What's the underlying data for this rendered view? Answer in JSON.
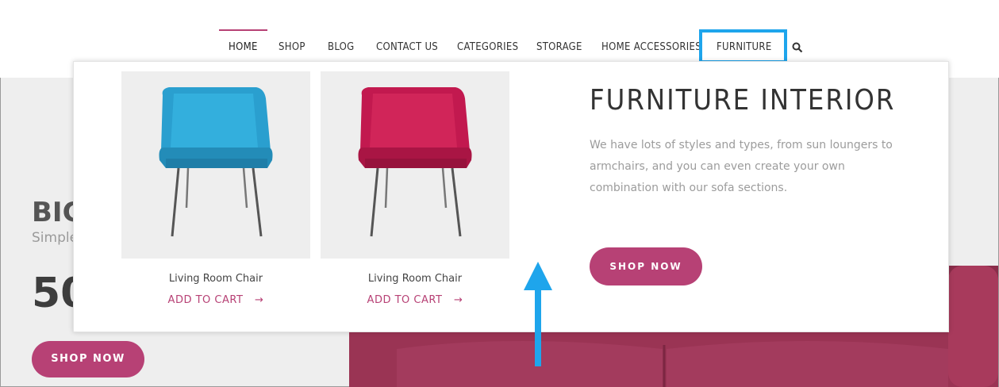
{
  "nav": {
    "items": [
      "HOME",
      "SHOP",
      "BLOG",
      "CONTACT US",
      "CATEGORIES",
      "STORAGE",
      "HOME ACCESSORIES",
      "FURNITURE"
    ]
  },
  "hero": {
    "title": "BIG",
    "subtitle": "Simple",
    "price": "50",
    "button": "SHOP NOW"
  },
  "mega_menu": {
    "products": [
      {
        "name": "Living Room Chair",
        "action": "ADD TO CART",
        "arrow": "→",
        "color": "#2a9fcf"
      },
      {
        "name": "Living Room Chair",
        "action": "ADD TO CART",
        "arrow": "→",
        "color": "#c2194f"
      }
    ],
    "promo_title": "FURNITURE INTERIOR",
    "promo_text": "We have lots of styles and types, from sun loungers to armchairs, and you can even create your own combination with our sofa sections.",
    "promo_button": "SHOP NOW"
  },
  "colors": {
    "accent": "#b74175",
    "highlight": "#1ea5ec"
  }
}
